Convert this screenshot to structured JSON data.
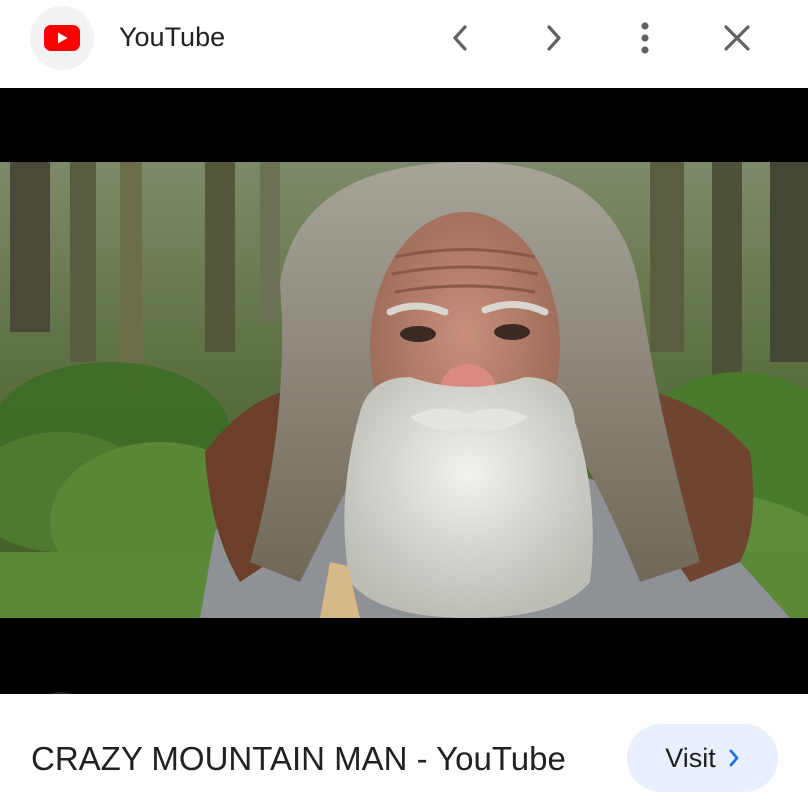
{
  "header": {
    "site_name": "YouTube",
    "favicon": "youtube-logo-icon",
    "back_icon": "chevron-left-icon",
    "forward_icon": "chevron-right-icon",
    "menu_icon": "more-vertical-icon",
    "close_icon": "close-icon"
  },
  "preview": {
    "lens_icon": "lens-search-icon"
  },
  "footer": {
    "title": "CRAZY MOUNTAIN MAN - YouTube",
    "visit_label": "Visit",
    "visit_icon": "chevron-right-icon"
  },
  "colors": {
    "youtube_red": "#ff0000",
    "visit_bg": "#e8f0fe",
    "visit_chevron": "#1a73e8",
    "icon_gray": "#5f6368"
  }
}
